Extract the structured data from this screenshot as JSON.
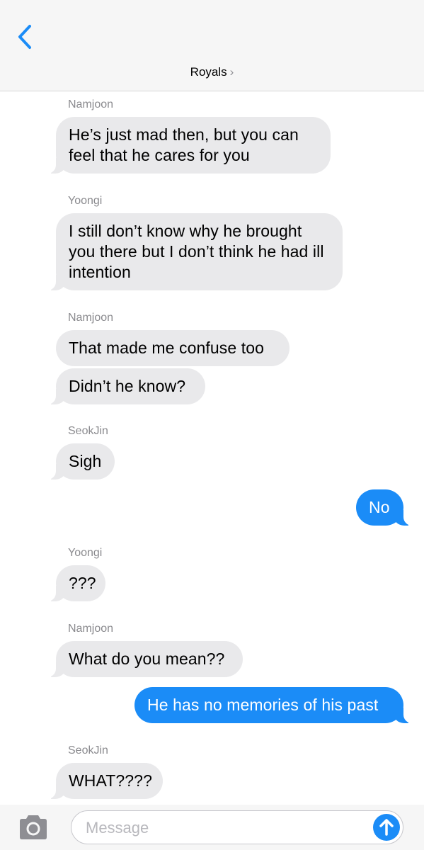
{
  "header": {
    "back_icon": "chevron-left-icon",
    "group_name": "Royals",
    "group_chevron": "›",
    "accent_color": "#1b8cf7"
  },
  "messages": [
    {
      "sender": "Namjoon",
      "text": "He’s just mad then, but you can feel that he cares for you"
    },
    {
      "sender": "Yoongi",
      "text": "I still don’t know why he brought you there but I don’t think he had ill intention"
    },
    {
      "sender": "Namjoon",
      "text": "That made me confuse too"
    },
    {
      "text": "Didn’t he know?"
    },
    {
      "sender": "SeokJin",
      "text": "Sigh"
    },
    {
      "text": "No",
      "outgoing": true
    },
    {
      "sender": "Yoongi",
      "text": "???"
    },
    {
      "sender": "Namjoon",
      "text": "What do you mean??"
    },
    {
      "text": "He has no memories of his past",
      "outgoing": true
    },
    {
      "sender": "SeokJin",
      "text": "WHAT????"
    }
  ],
  "composer": {
    "placeholder": "Message",
    "camera_icon": "camera-icon",
    "send_icon": "arrow-up-icon"
  }
}
